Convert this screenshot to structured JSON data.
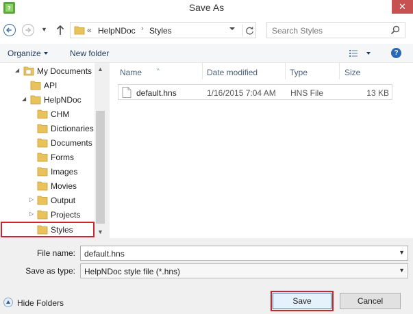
{
  "window": {
    "title": "Save As",
    "close_glyph": "✕"
  },
  "nav": {
    "breadcrumb_prefix": "«",
    "crumbs": [
      "HelpNDoc",
      "Styles"
    ],
    "crumb_separator": "›",
    "search_placeholder": "Search Styles"
  },
  "toolbar": {
    "organize_label": "Organize",
    "new_folder_label": "New folder",
    "help_glyph": "?"
  },
  "tree": {
    "items": [
      {
        "label": "My Documents",
        "twisty": "◢"
      },
      {
        "label": "API",
        "twisty": ""
      },
      {
        "label": "HelpNDoc",
        "twisty": "◢"
      },
      {
        "label": "CHM",
        "twisty": ""
      },
      {
        "label": "Dictionaries",
        "twisty": ""
      },
      {
        "label": "Documents",
        "twisty": ""
      },
      {
        "label": "Forms",
        "twisty": ""
      },
      {
        "label": "Images",
        "twisty": ""
      },
      {
        "label": "Movies",
        "twisty": ""
      },
      {
        "label": "Output",
        "twisty": "▷"
      },
      {
        "label": "Projects",
        "twisty": "▷"
      },
      {
        "label": "Styles",
        "twisty": ""
      }
    ],
    "selected": "Styles",
    "scroll_up_glyph": "▲",
    "scroll_down_glyph": "▼"
  },
  "filelist": {
    "columns": [
      "Name",
      "Date modified",
      "Type",
      "Size"
    ],
    "sort_glyph": "^",
    "rows": [
      {
        "name": "default.hns",
        "date": "1/16/2015 7:04 AM",
        "type": "HNS File",
        "size": "13 KB"
      }
    ]
  },
  "form": {
    "file_name_label": "File name:",
    "file_name_value": "default.hns",
    "save_type_label": "Save as type:",
    "save_type_value": "HelpNDoc style file  (*.hns)",
    "dropdown_glyph": "▼"
  },
  "footer": {
    "hide_folders_label": "Hide Folders",
    "save_label": "Save",
    "cancel_label": "Cancel"
  },
  "colors": {
    "accent": "#2a67b4",
    "highlight_red": "#d0232a",
    "folder_yellow": "#e8c25a"
  }
}
